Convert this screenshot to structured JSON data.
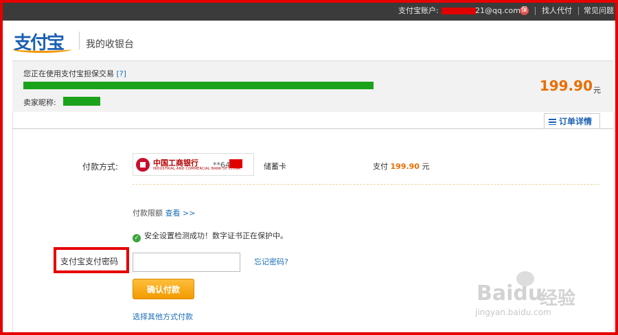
{
  "topbar": {
    "account_label": "支付宝账户:",
    "account_suffix": "21@qq.com",
    "protect_badge": "保",
    "links": [
      "找人代付",
      "常见问题"
    ]
  },
  "header": {
    "logo": "支付宝",
    "title": "我的收银台"
  },
  "summary": {
    "trade_text": "您正在使用支付宝担保交易",
    "help": "[?]",
    "seller_label": "卖家昵称:",
    "amount": "199.90",
    "amount_unit": "元"
  },
  "order_tab": {
    "label": "订单详情"
  },
  "payment": {
    "method_label": "付款方式:",
    "bank_name": "中国工商银行",
    "bank_name_en": "INDUSTRIAL AND COMMERCIAL BANK OF CHINA",
    "card_number": "**64",
    "card_type": "储蓄卡",
    "pay_prefix": "支付",
    "pay_amount": "199.90",
    "pay_unit": "元"
  },
  "limit": {
    "label": "付款限额",
    "link": "查看 >>"
  },
  "security": {
    "message": "安全设置检测成功！数字证书正在保护中。"
  },
  "password": {
    "label": "支付宝支付密码",
    "forgot": "忘记密码?",
    "value": ""
  },
  "buttons": {
    "confirm": "确认付款"
  },
  "other_method": "选择其他方式付款",
  "watermark": {
    "text": "Bai",
    "suffix": "du",
    "cn": "经验",
    "url": "jingyan.baidu.com"
  },
  "colors": {
    "accent_orange": "#e86e00",
    "link_blue": "#1a6fb8",
    "highlight_red": "#e60000"
  },
  "icons": [
    "list-icon",
    "check-circle-icon",
    "icbc-logo-icon"
  ]
}
